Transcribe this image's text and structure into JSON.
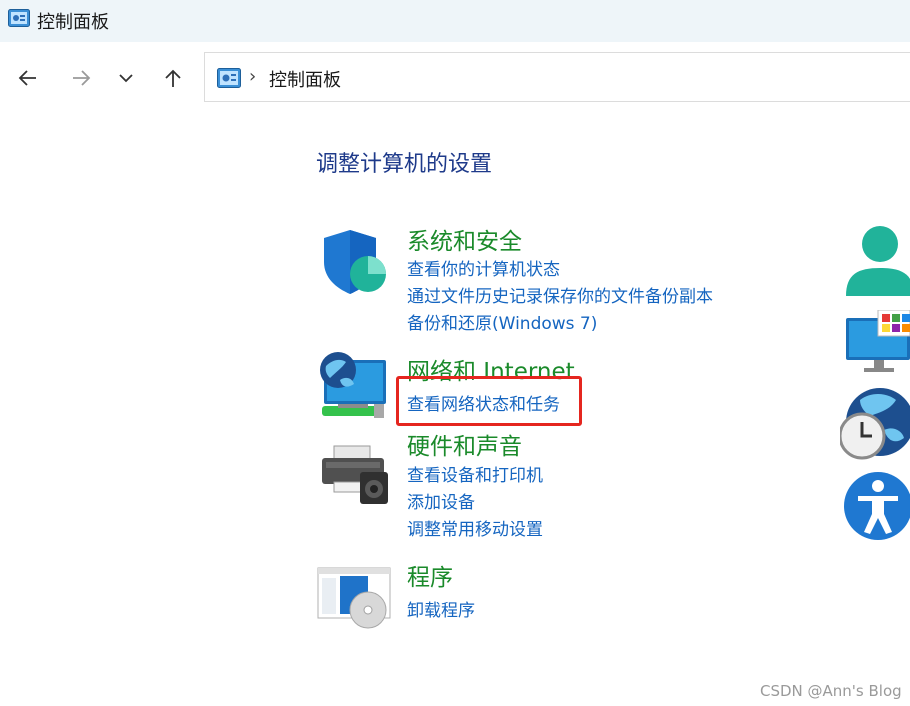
{
  "window": {
    "title": "控制面板"
  },
  "address": {
    "path": "控制面板"
  },
  "main": {
    "heading": "调整计算机的设置",
    "categories": [
      {
        "title": "系统和安全",
        "links": [
          "查看你的计算机状态",
          "通过文件历史记录保存你的文件备份副本",
          "备份和还原(Windows 7)"
        ]
      },
      {
        "title": "网络和 Internet",
        "links": [
          "查看网络状态和任务"
        ]
      },
      {
        "title": "硬件和声音",
        "links": [
          "查看设备和打印机",
          "添加设备",
          "调整常用移动设置"
        ]
      },
      {
        "title": "程序",
        "links": [
          "卸载程序"
        ]
      }
    ]
  },
  "watermark": "CSDN @Ann's Blog",
  "colors": {
    "category_title": "#1a8a2a",
    "link": "#1565c0",
    "heading": "#1e3a8a",
    "highlight": "#e5261f"
  }
}
